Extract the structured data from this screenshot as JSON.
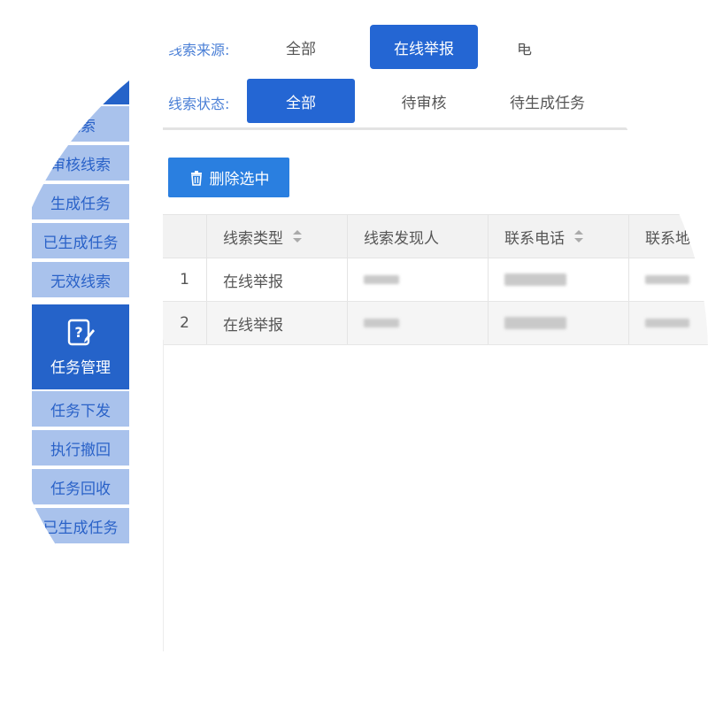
{
  "sidebar": {
    "items_top": [
      {
        "label": "线索"
      },
      {
        "label": "审核线索"
      },
      {
        "label": "生成任务"
      },
      {
        "label": "已生成任务"
      },
      {
        "label": "无效线索"
      }
    ],
    "section": {
      "label": "任务管理",
      "icon": "task-edit-icon"
    },
    "items_bottom": [
      {
        "label": "任务下发"
      },
      {
        "label": "执行撤回"
      },
      {
        "label": "任务回收"
      },
      {
        "label": "已生成任务"
      }
    ]
  },
  "filters": {
    "source": {
      "label": "线索来源:",
      "options": [
        "全部",
        "在线举报",
        "电"
      ],
      "active_index": 1
    },
    "status": {
      "label": "线索状态:",
      "options": [
        "全部",
        "待审核",
        "待生成任务"
      ],
      "active_index": 0
    }
  },
  "toolbar": {
    "delete_label": "删除选中"
  },
  "table": {
    "columns": [
      "",
      "线索类型",
      "线索发现人",
      "联系电话",
      "联系地"
    ],
    "rows": [
      {
        "index": "1",
        "type": "在线举报"
      },
      {
        "index": "2",
        "type": "在线举报"
      }
    ]
  },
  "colors": {
    "primary": "#2466d3",
    "sidebar_light": "#a9c2ec",
    "button": "#2a7fe0"
  }
}
